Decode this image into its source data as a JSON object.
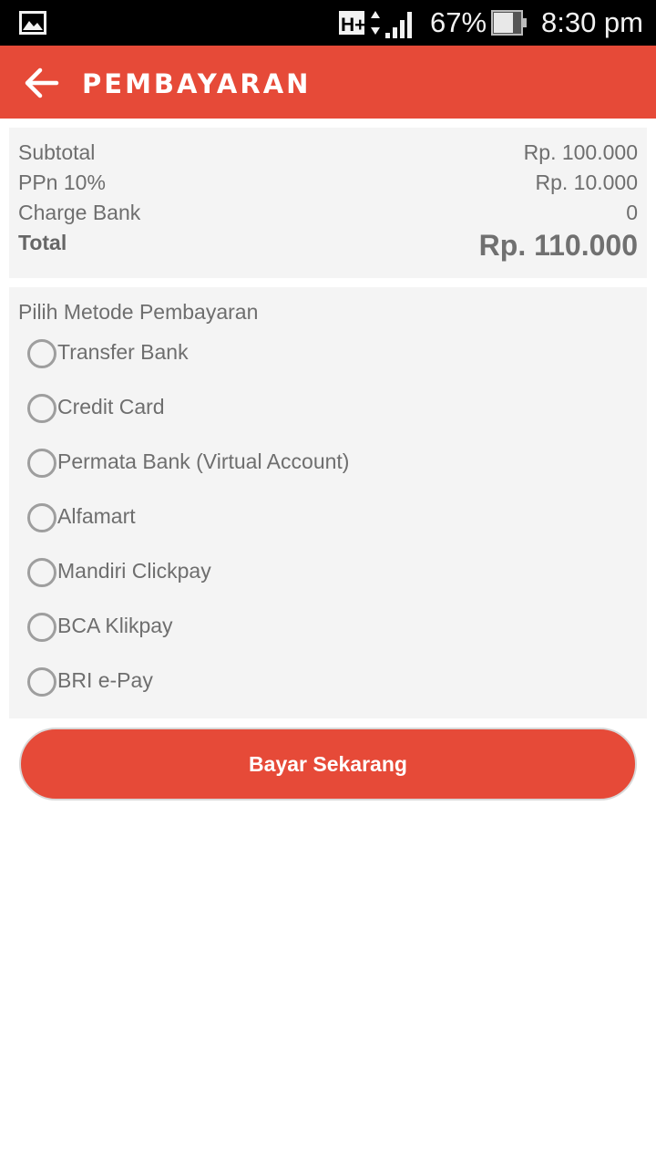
{
  "status_bar": {
    "network": "H+",
    "battery": "67%",
    "time": "8:30 pm",
    "icons": [
      "gallery-icon",
      "network-h-plus-icon",
      "signal-icon",
      "battery-icon"
    ]
  },
  "app_bar": {
    "title": "PEMBAYARAN",
    "back_icon": "arrow-left-icon",
    "color": "#e64a38"
  },
  "summary": {
    "rows": [
      {
        "label": "Subtotal",
        "value": "Rp. 100.000"
      },
      {
        "label": "PPn 10%",
        "value": "Rp. 10.000"
      },
      {
        "label": "Charge Bank",
        "value": "0"
      }
    ],
    "total": {
      "label": "Total",
      "value": "Rp. 110.000"
    }
  },
  "payment": {
    "title": "Pilih Metode Pembayaran",
    "methods": [
      {
        "label": "Transfer Bank",
        "selected": false
      },
      {
        "label": "Credit Card",
        "selected": false
      },
      {
        "label": "Permata Bank (Virtual Account)",
        "selected": false
      },
      {
        "label": "Alfamart",
        "selected": false
      },
      {
        "label": "Mandiri Clickpay",
        "selected": false
      },
      {
        "label": "BCA Klikpay",
        "selected": false
      },
      {
        "label": "BRI e-Pay",
        "selected": false
      }
    ]
  },
  "pay_button": {
    "label": "Bayar Sekarang"
  }
}
